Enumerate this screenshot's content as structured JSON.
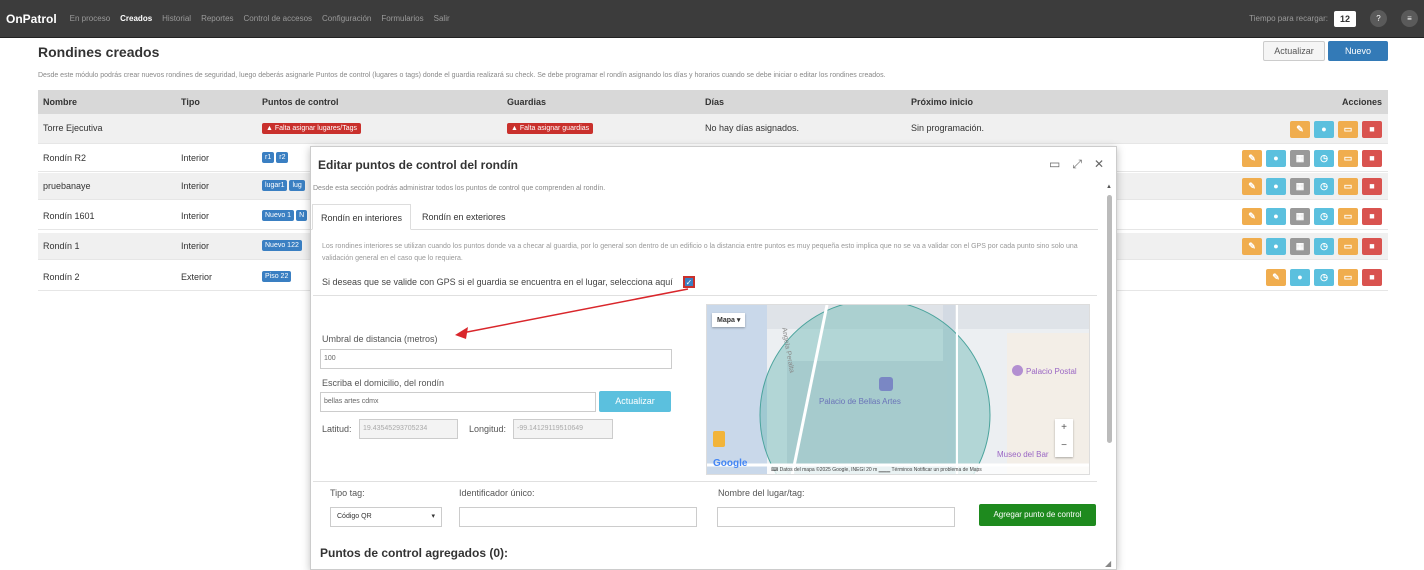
{
  "navbar": {
    "brand": "OnPatrol",
    "items": [
      "En proceso",
      "Creados",
      "Historial",
      "Reportes",
      "Control de accesos",
      "Configuración",
      "Formularios",
      "Salir"
    ],
    "reload_label": "Tiempo para recargar:",
    "reload_value": "12",
    "help_icon": "question-circle-icon",
    "menu_icon": "grid-menu-icon"
  },
  "page": {
    "title": "Rondines creados",
    "update_label": "Actualizar",
    "new_label": "Nuevo",
    "description": "Desde este módulo podrás crear nuevos rondines de seguridad, luego deberás asignarle Puntos de control (lugares o tags) donde el guardia realizará su check. Se debe programar el rondín asignando los días y horarios cuando se debe iniciar o editar los rondines creados."
  },
  "table": {
    "headers": [
      "Nombre",
      "Tipo",
      "Puntos de control",
      "Guardias",
      "Días",
      "Próximo inicio",
      "Acciones"
    ],
    "rows": [
      {
        "name": "Torre Ejecutiva",
        "type": "",
        "points": "Falta asignar lugares/Tags",
        "guards": "Falta asignar guardias",
        "days": "No hay días asignados.",
        "next": "Sin programación."
      },
      {
        "name": "Rondín R2",
        "type": "Interior",
        "tags": [
          "r1",
          "r2"
        ]
      },
      {
        "name": "pruebanaye",
        "type": "Interior",
        "tags": [
          "lugar1",
          "lug"
        ]
      },
      {
        "name": "Rondín 1601",
        "type": "Interior",
        "tags": [
          "Nuevo 1",
          "N"
        ]
      },
      {
        "name": "Rondín 1",
        "type": "Interior",
        "tags": [
          "Nuevo 122"
        ]
      },
      {
        "name": "Rondín 2",
        "type": "Exterior",
        "tags": [
          "Piso 22"
        ]
      }
    ]
  },
  "modal": {
    "title": "Editar puntos de control del rondín",
    "subtitle": "Desde esta sección podrás administrar todos los puntos de control que comprenden al rondín.",
    "tabs": [
      "Rondín en interiores",
      "Rondín en exteriores"
    ],
    "info": "Los rondines interiores se utilizan cuando los puntos donde va a checar al guardia, por lo general son dentro de un edificio o la distancia entre puntos es muy pequeña esto implica que no se va a validar con el GPS por cada punto sino solo una validación general en el caso que lo requiera.",
    "gps_label": "Si deseas que se valide con GPS si el guardia se encuentra en el lugar, selecciona aquí",
    "threshold_label": "Umbral de distancia (metros)",
    "threshold_value": "100",
    "address_label": "Escriba el domicilio, del rondín",
    "address_value": "bellas artes cdmx",
    "address_button": "Actualizar",
    "lat_label": "Latitud:",
    "lat_value": "19.435452937052​34",
    "lng_label": "Longitud:",
    "lng_value": "-99.14129119510649",
    "map": {
      "type_label": "Mapa",
      "street": "Angela Peralta",
      "place1": "Palacio de Bellas Artes",
      "place2": "Palacio Postal",
      "place3": "Museo del Bar",
      "google": "Google",
      "footer": "Datos del mapa ©2025 Google, INEGI",
      "scale": "20 m",
      "terms": "Términos",
      "report": "Notificar un problema de Maps"
    },
    "tag_type_label": "Tipo tag:",
    "tag_type_value": "Código QR",
    "identifier_label": "Identificador único:",
    "place_name_label": "Nombre del lugar/tag:",
    "add_button": "Agregar punto de control",
    "points_title": "Puntos de control agregados (0):"
  }
}
